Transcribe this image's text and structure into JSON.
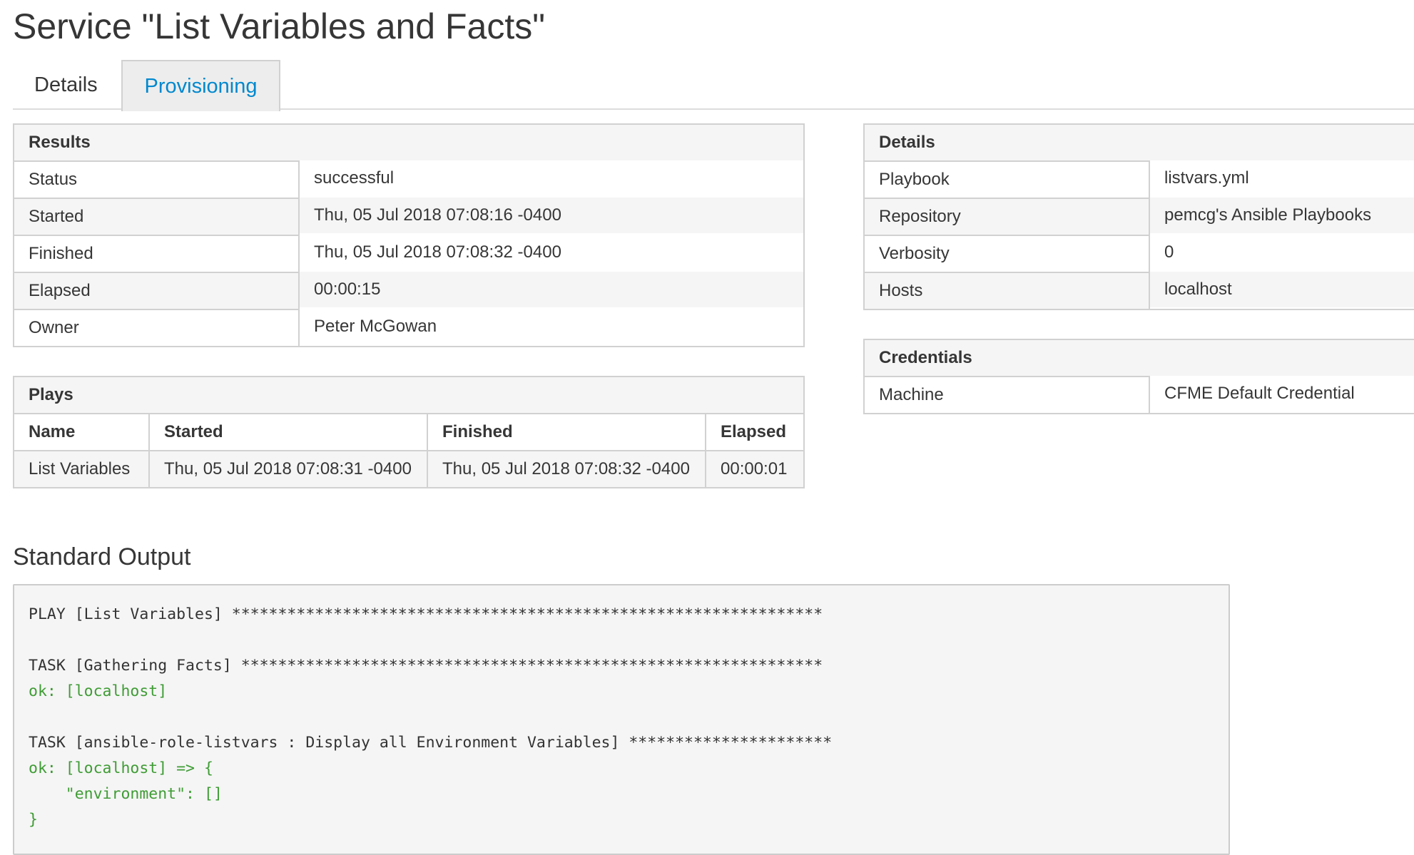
{
  "page": {
    "title": "Service \"List Variables and Facts\""
  },
  "tabs": [
    {
      "label": "Details",
      "active": false
    },
    {
      "label": "Provisioning",
      "active": true
    }
  ],
  "results": {
    "heading": "Results",
    "rows": [
      {
        "label": "Status",
        "value": "successful"
      },
      {
        "label": "Started",
        "value": "Thu, 05 Jul 2018 07:08:16 -0400"
      },
      {
        "label": "Finished",
        "value": "Thu, 05 Jul 2018 07:08:32 -0400"
      },
      {
        "label": "Elapsed",
        "value": "00:00:15"
      },
      {
        "label": "Owner",
        "value": "Peter McGowan"
      }
    ]
  },
  "details": {
    "heading": "Details",
    "rows": [
      {
        "label": "Playbook",
        "value": "listvars.yml"
      },
      {
        "label": "Repository",
        "value": "pemcg's Ansible Playbooks"
      },
      {
        "label": "Verbosity",
        "value": "0"
      },
      {
        "label": "Hosts",
        "value": "localhost"
      }
    ]
  },
  "credentials": {
    "heading": "Credentials",
    "rows": [
      {
        "label": "Machine",
        "value": "CFME Default Credential"
      }
    ]
  },
  "plays": {
    "heading": "Plays",
    "columns": [
      "Name",
      "Started",
      "Finished",
      "Elapsed"
    ],
    "rows": [
      [
        "List Variables",
        "Thu, 05 Jul 2018 07:08:31 -0400",
        "Thu, 05 Jul 2018 07:08:32 -0400",
        "00:00:01"
      ]
    ]
  },
  "standard_output": {
    "heading": "Standard Output",
    "lines": [
      {
        "text": "PLAY [List Variables] ****************************************************************",
        "color": "#333333"
      },
      {
        "text": "",
        "color": "#333333"
      },
      {
        "text": "TASK [Gathering Facts] ***************************************************************",
        "color": "#333333"
      },
      {
        "text": "ok: [localhost]",
        "color": "#3f9c35"
      },
      {
        "text": "",
        "color": "#333333"
      },
      {
        "text": "TASK [ansible-role-listvars : Display all Environment Variables] **********************",
        "color": "#333333"
      },
      {
        "text": "ok: [localhost] => {",
        "color": "#3f9c35"
      },
      {
        "text": "    \"environment\": []",
        "color": "#3f9c35"
      },
      {
        "text": "}",
        "color": "#3f9c35"
      }
    ]
  },
  "colors": {
    "accent": "#0088ce",
    "ok_green": "#3f9c35",
    "panel_bg": "#f5f5f5",
    "border": "#d1d1d1"
  }
}
